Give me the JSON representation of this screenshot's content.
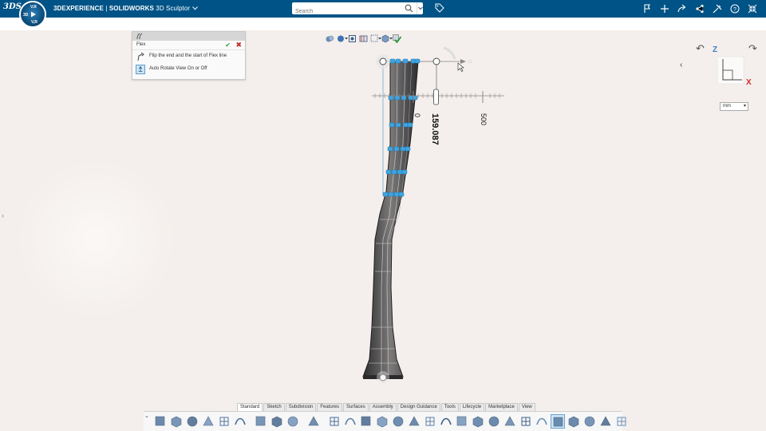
{
  "topbar": {
    "logo": "3DS",
    "compass_labels": {
      "top": "V.R",
      "left": "3D",
      "right": "",
      "bottom": "V,R"
    },
    "brand": "3DEXPERIENCE",
    "separator": " | ",
    "product": "SOLIDWORKS",
    "app": "3D Sculptor",
    "search_placeholder": "Search",
    "right_icons": [
      "flag-icon",
      "plus-icon",
      "share-arrow-icon",
      "share-network-icon",
      "tools-icon",
      "help-icon",
      "collapse-arrows-icon"
    ]
  },
  "flex_panel": {
    "title": "Flex",
    "options": [
      {
        "label": "Flip the end and the start of Flex line",
        "icon": "flip-icon",
        "selected": false
      },
      {
        "label": "Auto Rotate View On or Off",
        "icon": "auto-rotate-icon",
        "selected": true
      }
    ]
  },
  "view_toolbar": [
    "display-style-icon",
    "appearance-icon",
    "view-orientation-icon",
    "section-view-icon",
    "selection-box-icon",
    "cube-view-icon",
    "apply-icon"
  ],
  "triad": {
    "z": "Z",
    "x": "X"
  },
  "units": {
    "selected": "mm"
  },
  "ruler": {
    "tick_labels": [
      "0",
      "500"
    ],
    "value": "159.087"
  },
  "command_tabs": [
    {
      "label": "Standard",
      "active": true
    },
    {
      "label": "Sketch",
      "active": false
    },
    {
      "label": "Subdivision",
      "active": false
    },
    {
      "label": "Features",
      "active": false
    },
    {
      "label": "Surfaces",
      "active": false
    },
    {
      "label": "Assembly",
      "active": false
    },
    {
      "label": "Design Guidance",
      "active": false
    },
    {
      "label": "Tools",
      "active": false
    },
    {
      "label": "Lifecycle",
      "active": false
    },
    {
      "label": "Marketplace",
      "active": false
    },
    {
      "label": "View",
      "active": false
    }
  ],
  "command_icons": [
    "new-part-icon",
    "open-icon",
    "save-icon",
    "rebuild-icon",
    "save-as-icon",
    "options-icon",
    "undo-icon",
    "redo-icon",
    "help-icon",
    "table-icon",
    "box-icon",
    "grid-icon",
    "mesh-icon",
    "extrude-icon",
    "revolve-icon",
    "sweep-icon",
    "loft-icon",
    "shell-icon",
    "fillet-icon",
    "chamfer-icon",
    "cube-icon",
    "pattern-icon",
    "sphere-icon",
    "draft-icon",
    "flex-icon",
    "deform-icon",
    "body-icon",
    "taper-icon",
    "wrap-icon"
  ]
}
